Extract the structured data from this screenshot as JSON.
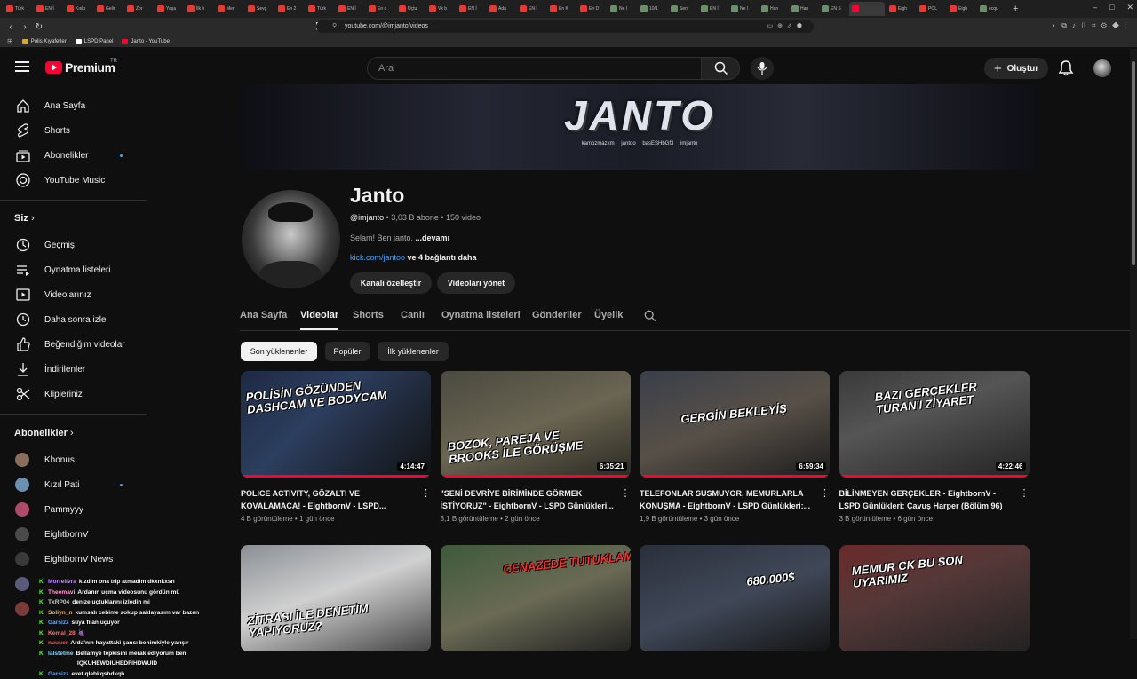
{
  "browser": {
    "tabs": [
      {
        "label": "Türk",
        "fav": "r"
      },
      {
        "label": "EN İ",
        "fav": "r"
      },
      {
        "label": "Kıskı",
        "fav": "r"
      },
      {
        "label": "Gelir",
        "fav": "r"
      },
      {
        "label": "Zor",
        "fav": "r"
      },
      {
        "label": "Yaşa",
        "fav": "r"
      },
      {
        "label": "İlk b",
        "fav": "r"
      },
      {
        "label": "Mer",
        "fav": "r"
      },
      {
        "label": "Sevg",
        "fav": "r"
      },
      {
        "label": "En 2",
        "fav": "r"
      },
      {
        "label": "Türk",
        "fav": "r"
      },
      {
        "label": "EN İ",
        "fav": "r"
      },
      {
        "label": "En o",
        "fav": "r"
      },
      {
        "label": "Uçtu",
        "fav": "r"
      },
      {
        "label": "Vk b",
        "fav": "r"
      },
      {
        "label": "EN İ",
        "fav": "r"
      },
      {
        "label": "Ada",
        "fav": "r"
      },
      {
        "label": "EN İ",
        "fav": "r"
      },
      {
        "label": "En K",
        "fav": "r"
      },
      {
        "label": "En D",
        "fav": "r"
      },
      {
        "label": "Ne l",
        "fav": "g"
      },
      {
        "label": "10/1",
        "fav": "g"
      },
      {
        "label": "Seni",
        "fav": "g"
      },
      {
        "label": "EN İ",
        "fav": "g"
      },
      {
        "label": "Ne l",
        "fav": "g"
      },
      {
        "label": "Han",
        "fav": "g"
      },
      {
        "label": "Han",
        "fav": "g"
      },
      {
        "label": "EN S",
        "fav": "g"
      },
      {
        "label": "",
        "fav": "y",
        "active": true
      },
      {
        "label": "Eigh",
        "fav": "r"
      },
      {
        "label": "POL",
        "fav": "r"
      },
      {
        "label": "Eigh",
        "fav": "r"
      },
      {
        "label": "ecqu",
        "fav": "g"
      }
    ],
    "new_tab": "+",
    "window_controls": [
      "–",
      "□",
      "✕"
    ],
    "url": "youtube.com/@imjanto/videos",
    "bookmarks": [
      {
        "label": "Polis Kıyafetler",
        "icon": "folder-icon"
      },
      {
        "label": "LSPD Panel",
        "icon": "page-icon"
      },
      {
        "label": "Janto - YouTube",
        "icon": "youtube-icon"
      }
    ]
  },
  "header": {
    "logo_text": "Premium",
    "logo_country": "TR",
    "search_placeholder": "Ara",
    "create_label": "Oluştur"
  },
  "sidebar": {
    "main": [
      {
        "label": "Ana Sayfa",
        "icon": "home-icon"
      },
      {
        "label": "Shorts",
        "icon": "shorts-icon"
      },
      {
        "label": "Abonelikler",
        "icon": "subscriptions-icon"
      },
      {
        "label": "YouTube Music",
        "icon": "music-icon"
      }
    ],
    "you_heading": "Siz",
    "you": [
      {
        "label": "Geçmiş",
        "icon": "history-icon"
      },
      {
        "label": "Oynatma listeleri",
        "icon": "playlists-icon"
      },
      {
        "label": "Videolarınız",
        "icon": "your-videos-icon"
      },
      {
        "label": "Daha sonra izle",
        "icon": "watch-later-icon"
      },
      {
        "label": "Beğendiğim videolar",
        "icon": "liked-icon"
      },
      {
        "label": "İndirilenler",
        "icon": "downloads-icon"
      },
      {
        "label": "Klipleriniz",
        "icon": "clips-icon"
      }
    ],
    "subs_heading": "Abonelikler",
    "subscriptions": [
      {
        "label": "Khonus",
        "color": "#8a6d5a"
      },
      {
        "label": "Kızıl Pati",
        "color": "#6a8fb0"
      },
      {
        "label": "Pammyyy",
        "color": "#b04a6a"
      },
      {
        "label": "EightbornV",
        "color": "#4a4a4a"
      },
      {
        "label": "EightbornV News",
        "color": "#3a3a3a"
      },
      {
        "label": "",
        "color": "#5a5a7a"
      },
      {
        "label": "",
        "color": "#7a3a3a"
      }
    ]
  },
  "channel": {
    "banner_title": "JANTO",
    "banner_socials": "kamozmazkm  jantoo  basESHbGf3  imjanto",
    "name": "Janto",
    "handle": "@imjanto",
    "meta": " • 3,03 B abone • 150 video",
    "description": "Selam! Ben janto. ",
    "more": "...devamı",
    "link": "kick.com/jantoo",
    "link_more": " ve 4 bağlantı daha",
    "customize_label": "Kanalı özelleştir",
    "manage_label": "Videoları yönet"
  },
  "tabs": [
    "Ana Sayfa",
    "Videolar",
    "Shorts",
    "Canlı",
    "Oynatma listeleri",
    "Gönderiler",
    "Üyelik"
  ],
  "selected_tab": "Videolar",
  "chips": [
    "Son yüklenenler",
    "Popüler",
    "İlk yüklenenler"
  ],
  "videos": [
    {
      "title": "POLICE ACTIVITY, GÖZALTI VE KOVALAMACA! - EightbornV - LSPD...",
      "views": "4 B görüntüleme",
      "age": "1 gün önce",
      "duration": "4:14:47",
      "thumb_text": "POLİSİN GÖZÜNDEN DASHCAM VE BODYCAM"
    },
    {
      "title": "\"SENİ DEVRİYE BİRİMİNDE GÖRMEK İSTİYORUZ\" - EightbornV - LSPD Günlükleri...",
      "views": "3,1 B görüntüleme",
      "age": "2 gün önce",
      "duration": "6:35:21",
      "thumb_text": "BOZOK, PAREJA VE BROOKS İLE GÖRÜŞME"
    },
    {
      "title": "TELEFONLAR SUSMUYOR, MEMURLARLA KONUŞMA - EightbornV - LSPD Günlükleri:...",
      "views": "1,9 B görüntüleme",
      "age": "3 gün önce",
      "duration": "6:59:34",
      "thumb_text": "GERGİN BEKLEYİŞ"
    },
    {
      "title": "BİLİNMEYEN GERÇEKLER - EightbornV - LSPD Günlükleri: Çavuş Harper (Bölüm 96)",
      "views": "3 B görüntüleme",
      "age": "6 gün önce",
      "duration": "4:22:46",
      "thumb_text": "BAZI GERÇEKLER TURAN'I ZİYARET"
    },
    {
      "title": "",
      "views": "",
      "age": "",
      "duration": "",
      "thumb_text": "ZİTRASI İLE DENETİM YAPIYORUZ?"
    },
    {
      "title": "",
      "views": "",
      "age": "",
      "duration": "",
      "thumb_text": "CENAZEDE TUTUKLAMA"
    },
    {
      "title": "",
      "views": "",
      "age": "",
      "duration": "",
      "thumb_text": "680.000$"
    },
    {
      "title": "",
      "views": "",
      "age": "",
      "duration": "",
      "thumb_text": "MEMUR CK  BU SON UYARIMIZ"
    }
  ],
  "chat": [
    {
      "user": "Morrelivra",
      "msg": "kizdim ona trip atmadim dkxnkxsn",
      "color": "#c08cff"
    },
    {
      "user": "Theemavi",
      "msg": "Ardanın uçma videosunu gördün mü",
      "color": "#ff9ad0"
    },
    {
      "user": "TxRP04",
      "msg": "denize uçtuklarını izledin mi",
      "color": "#c8c8c8"
    },
    {
      "user": "Soliyn_n",
      "msg": "kumsalı cebime sokup saklayasım var bazen",
      "color": "#ffb36b"
    },
    {
      "user": "Garsizz",
      "msg": "suya filan uçuyor",
      "color": "#5fa8ff"
    },
    {
      "user": "Kemal_28",
      "msg": "🍇",
      "color": "#ff6b6b"
    },
    {
      "user": "nuuuer",
      "msg": "Arda'nın hayattaki şansı benimkiyle yarışır",
      "color": "#ff4f4f"
    },
    {
      "user": "lalstetme",
      "msg": "Bellamye tepkisini merak ediyorum ben",
      "color": "#7fd4ff"
    },
    {
      "user": "",
      "msg": "IQKUHEWDIUHEDFIHDWUID",
      "color": "#ffffff"
    },
    {
      "user": "Garsizz",
      "msg": "evet qlebkqsbdkqb",
      "color": "#5fa8ff"
    }
  ],
  "colors": {
    "accent": "#ff0033",
    "link": "#3ea6ff",
    "kick": "#53fc18"
  }
}
